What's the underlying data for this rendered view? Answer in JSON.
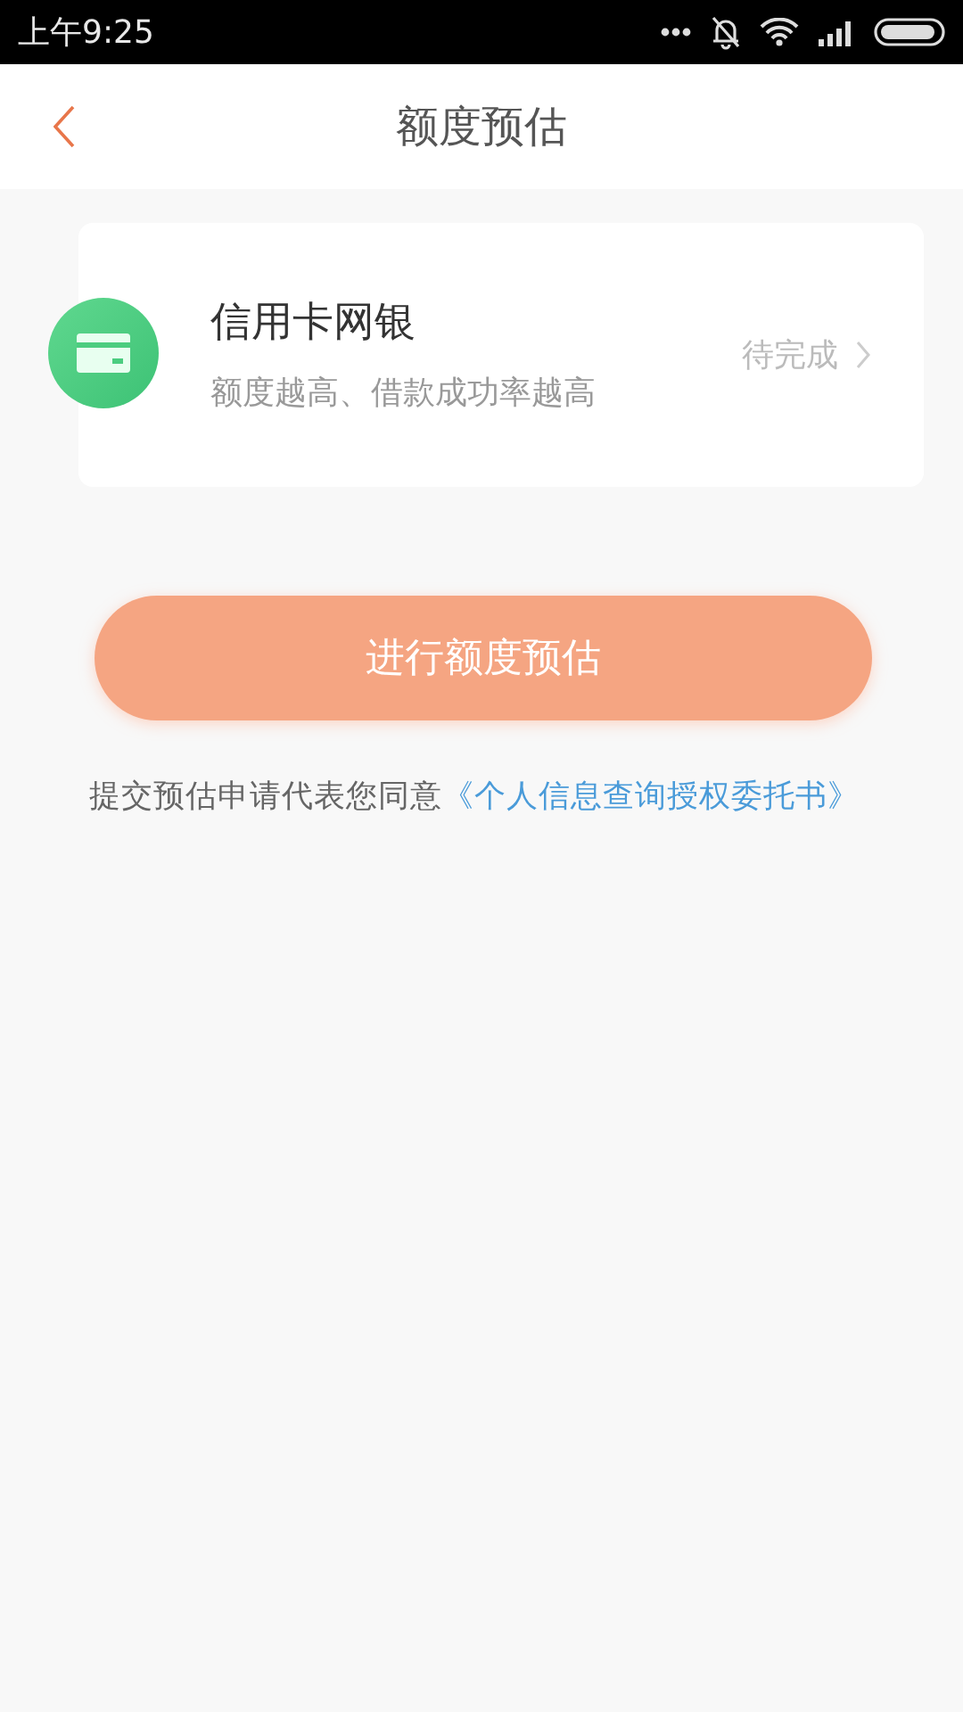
{
  "status_bar": {
    "time": "上午9:25"
  },
  "header": {
    "title": "额度预估"
  },
  "card": {
    "title": "信用卡网银",
    "subtitle": "额度越高、借款成功率越高",
    "status": "待完成"
  },
  "submit_button": {
    "label": "进行额度预估",
    "disabled": true
  },
  "agreement": {
    "text": "提交预估申请代表您同意",
    "link": "《个人信息查询授权委托书》"
  }
}
